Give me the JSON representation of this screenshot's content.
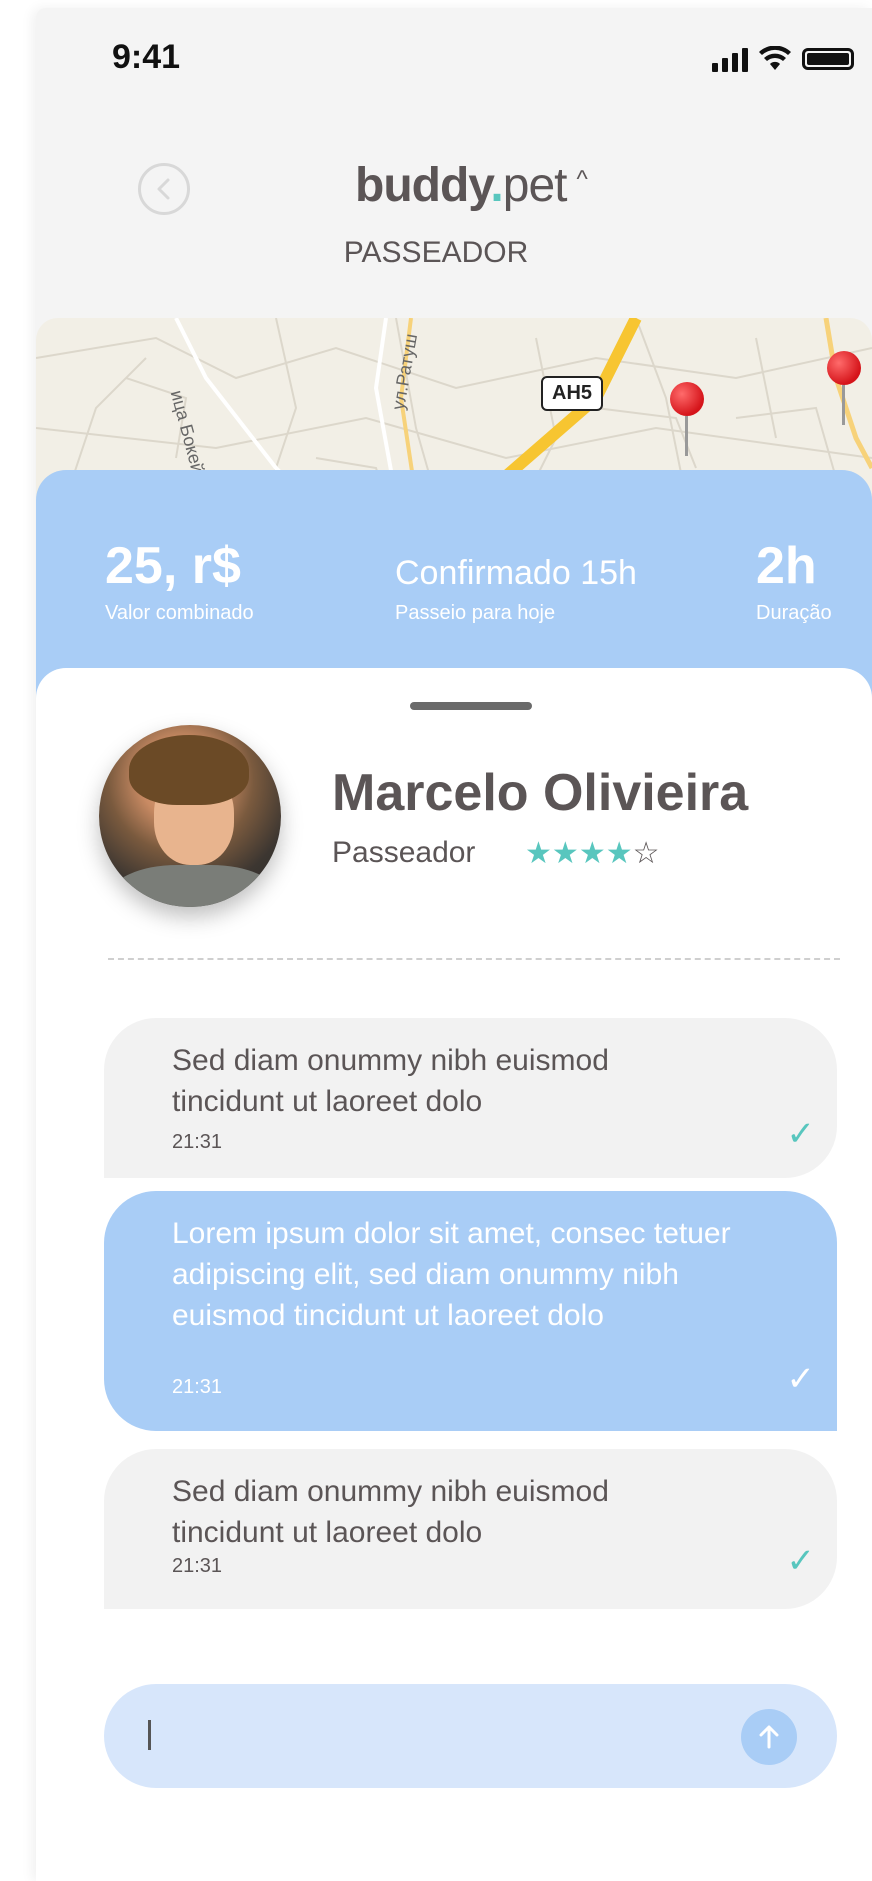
{
  "status_bar": {
    "time": "9:41"
  },
  "header": {
    "logo_bold": "buddy",
    "logo_dot": ".",
    "logo_light": "pet",
    "logo_caret": "^",
    "subtitle": "PASSEADOR"
  },
  "map": {
    "labels": [
      "ица Бокейхано",
      "ул.Ратуш"
    ],
    "road_shield": "AH5"
  },
  "ride": {
    "price_value": "25, r$",
    "price_label": "Valor combinado",
    "status_value": "Confirmado 15h",
    "status_label": "Passeio para hoje",
    "duration_value": "2h",
    "duration_label": "Duração"
  },
  "walker": {
    "name": "Marcelo Olivieira",
    "role": "Passeador",
    "rating": 4,
    "rating_max": 5
  },
  "messages": [
    {
      "text": "Sed diam onummy nibh euismod tincidunt ut laoreet dolo",
      "time": "21:31",
      "direction": "in"
    },
    {
      "text": "Lorem ipsum dolor sit amet, consec tetuer  adipiscing elit, sed diam onummy nibh euismod tincidunt ut laoreet dolo",
      "time": "21:31",
      "direction": "out"
    },
    {
      "text": "Sed diam onummy nibh euismod tincidunt ut laoreet dolo",
      "time": "21:31",
      "direction": "in"
    }
  ],
  "composer": {
    "value": "",
    "placeholder": ""
  },
  "colors": {
    "accent_blue": "#a9cdf6",
    "accent_teal": "#58c6be",
    "text_dark": "#5b5556",
    "background": "#f4f4f4"
  },
  "icons": [
    "signal-icon",
    "wifi-icon",
    "battery-icon",
    "back-arrow-icon",
    "check-icon",
    "send-arrow-icon",
    "map-pin-icon"
  ]
}
